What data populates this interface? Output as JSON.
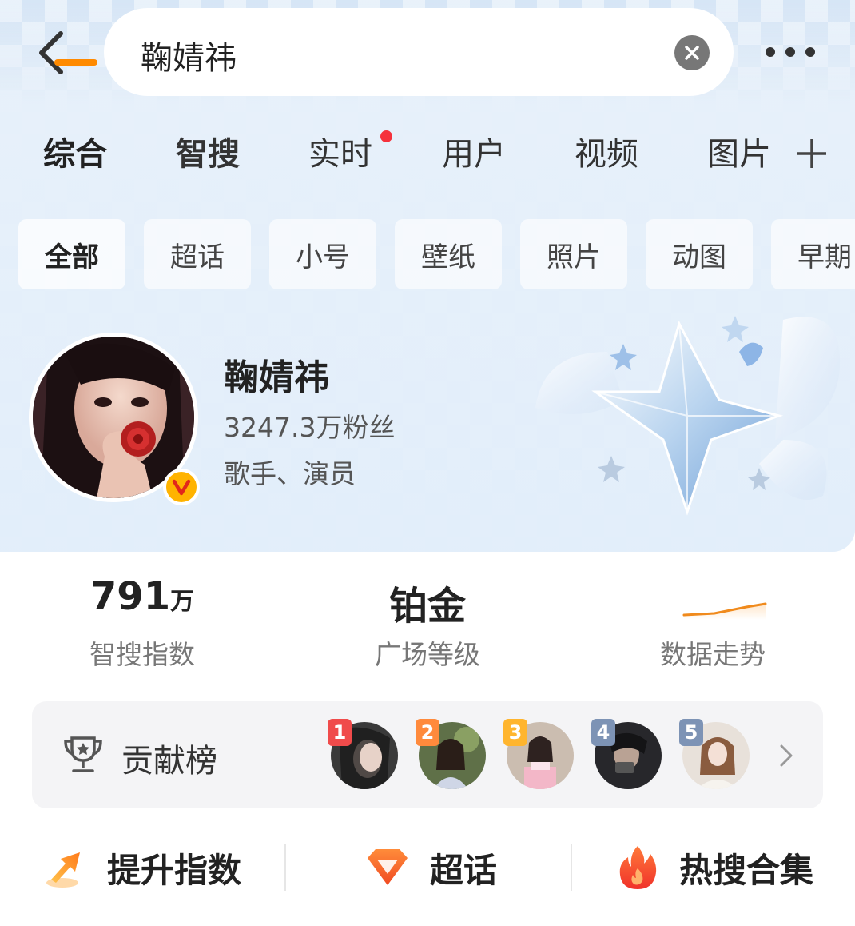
{
  "search": {
    "query": "鞠婧祎"
  },
  "tabs": [
    {
      "label": "综合",
      "active": true
    },
    {
      "label": "智搜"
    },
    {
      "label": "实时",
      "has_dot": true
    },
    {
      "label": "用户"
    },
    {
      "label": "视频"
    },
    {
      "label": "图片"
    }
  ],
  "chips": [
    "全部",
    "超话",
    "小号",
    "壁纸",
    "照片",
    "动图",
    "早期"
  ],
  "profile": {
    "name": "鞠婧祎",
    "fans": "3247.3万粉丝",
    "tags": "歌手、演员",
    "verified_badge": "V"
  },
  "stats": [
    {
      "value": "791",
      "unit": "万",
      "label": "智搜指数"
    },
    {
      "value": "铂金",
      "label": "广场等级"
    },
    {
      "label": "数据走势"
    }
  ],
  "contribution": {
    "label": "贡献榜",
    "fans": [
      {
        "rank": "1",
        "rank_color": "#f04b4b"
      },
      {
        "rank": "2",
        "rank_color": "#ff8a3c"
      },
      {
        "rank": "3",
        "rank_color": "#ffb52e"
      },
      {
        "rank": "4",
        "rank_color": "#7d93b5"
      },
      {
        "rank": "5",
        "rank_color": "#7d93b5"
      }
    ]
  },
  "actions": [
    {
      "label": "提升指数",
      "icon": "arrow-up-icon"
    },
    {
      "label": "超话",
      "icon": "diamond-icon"
    },
    {
      "label": "热搜合集",
      "icon": "flame-icon"
    }
  ],
  "colors": {
    "accent": "#ff8a00",
    "notification_dot": "#f5323c"
  }
}
